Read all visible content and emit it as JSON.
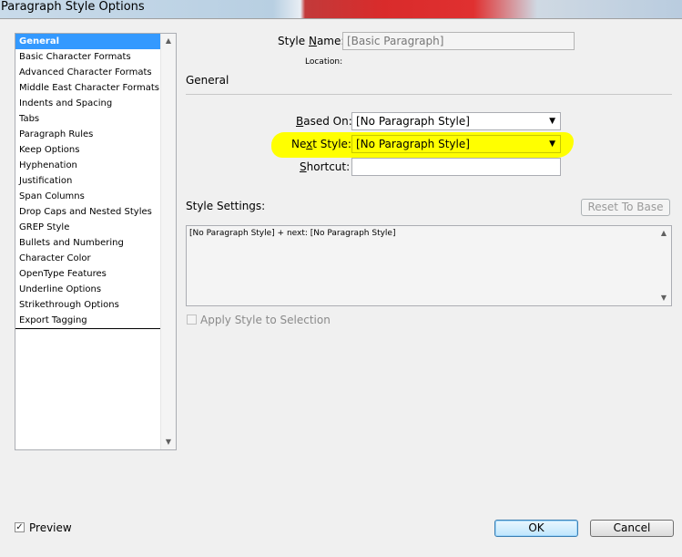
{
  "window": {
    "title": "Paragraph Style Options"
  },
  "categories": [
    "General",
    "Basic Character Formats",
    "Advanced Character Formats",
    "Middle East Character Formats",
    "Indents and Spacing",
    "Tabs",
    "Paragraph Rules",
    "Keep Options",
    "Hyphenation",
    "Justification",
    "Span Columns",
    "Drop Caps and Nested Styles",
    "GREP Style",
    "Bullets and Numbering",
    "Character Color",
    "OpenType Features",
    "Underline Options",
    "Strikethrough Options",
    "Export Tagging"
  ],
  "selected_category": "General",
  "style_name": {
    "label_pre": "Style ",
    "label_key": "N",
    "label_post": "ame:",
    "value": "[Basic Paragraph]"
  },
  "location_label": "Location:",
  "section_title": "General",
  "based_on": {
    "label_key": "B",
    "label_post": "ased On:",
    "value": "[No Paragraph Style]"
  },
  "next_style": {
    "label_pre": "Ne",
    "label_key": "x",
    "label_post": "t Style:",
    "value": "[No Paragraph Style]"
  },
  "shortcut": {
    "label_key": "S",
    "label_post": "hortcut:",
    "value": ""
  },
  "style_settings": {
    "label": "Style Settings:",
    "reset_label": "Reset To Base",
    "text": "[No Paragraph Style] + next: [No Paragraph Style]"
  },
  "apply_style_label": "Apply Style to Selection",
  "preview": {
    "label": "Preview",
    "checked": true
  },
  "ok_label": "OK",
  "cancel_label": "Cancel",
  "colors": {
    "selection": "#3399ff",
    "highlight": "#ffff00"
  }
}
